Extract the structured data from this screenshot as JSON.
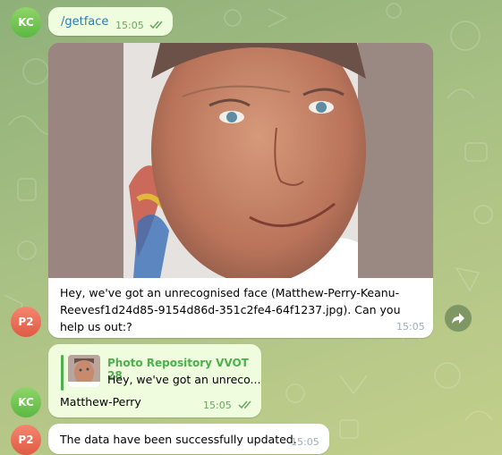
{
  "messages": [
    {
      "avatar": "KC",
      "text": "/getface",
      "time": "15:05",
      "status": "read"
    },
    {
      "avatar": "P2",
      "caption": "Hey, we've got an unrecognised face (Matthew-Perry-Keanu-Reevesf1d24d85-9154d86d-351c2fe4-64f1237.jpg). Can you help us out:?",
      "time": "15:05"
    },
    {
      "avatar": "KC",
      "reply": {
        "name": "Photo Repository VVOT 28",
        "text": "Hey, we've got an unreco..."
      },
      "text": "Matthew-Perry",
      "time": "15:05",
      "status": "read"
    },
    {
      "avatar": "P2",
      "text": "The data have been successfully updated.",
      "time": "15:05"
    }
  ],
  "colors": {
    "kc_avatar": "#5bb842",
    "p2_avatar": "#e05a44",
    "outgoing_bubble": "#effdde",
    "incoming_bubble": "#ffffff",
    "reply_accent": "#4fae4e",
    "command_link": "#2a7bba"
  },
  "icons": {
    "forward": "share-arrow-icon",
    "read_status": "double-check-icon"
  }
}
